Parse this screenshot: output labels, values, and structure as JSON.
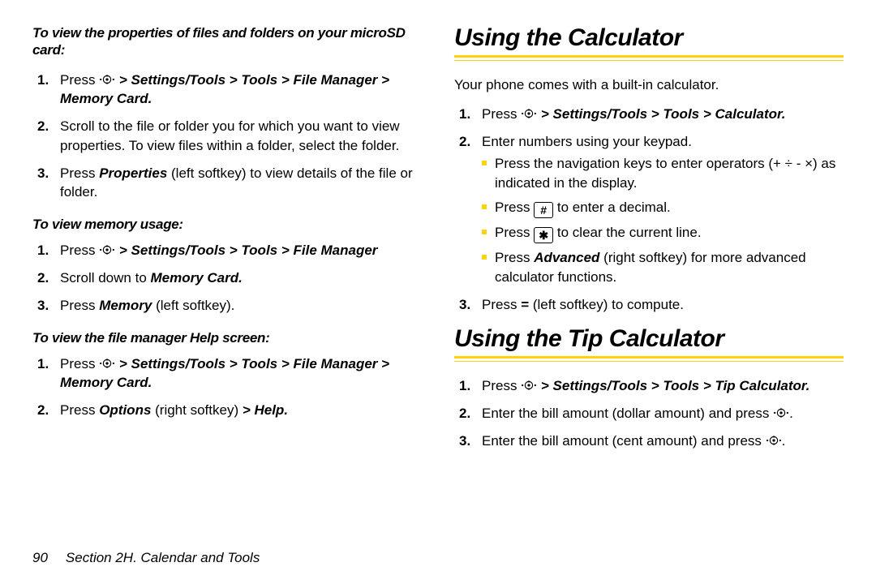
{
  "left": {
    "intro1": "To view the properties of files and folders on your microSD card:",
    "steps1": {
      "s1a": "Press ",
      "s1b": " > Settings/Tools > Tools > File Manager > Memory Card.",
      "s2": "Scroll to the file or folder you for which you want to view properties. To view files within a folder, select the folder.",
      "s3a": "Press ",
      "s3b": "Properties",
      "s3c": " (left softkey) to view details of the file or folder."
    },
    "sub2": "To view memory usage:",
    "steps2": {
      "s1a": "Press ",
      "s1b": " > Settings/Tools > Tools > File Manager",
      "s2a": "Scroll down to ",
      "s2b": "Memory Card.",
      "s3a": "Press ",
      "s3b": "Memory",
      "s3c": " (left softkey)."
    },
    "sub3": "To view the file manager Help screen:",
    "steps3": {
      "s1a": "Press ",
      "s1b": " > Settings/Tools > Tools > File Manager > Memory Card.",
      "s2a": "Press ",
      "s2b": "Options",
      "s2c": " (right softkey) ",
      "s2d": "> Help."
    }
  },
  "right": {
    "h1": "Using the Calculator",
    "intro1": "Your phone comes with a built-in calculator.",
    "steps1": {
      "s1a": "Press ",
      "s1b": " > Settings/Tools > Tools > Calculator.",
      "s2": "Enter numbers using your keypad.",
      "sub1a": "Press the navigation keys to enter operators (+ ",
      "sub1b": "÷",
      "sub1c": " - ×) as indicated in the display.",
      "sub2a": "Press ",
      "sub2b": " to enter a decimal.",
      "sub3a": "Press ",
      "sub3b": " to clear the current line.",
      "sub4a": "Press ",
      "sub4b": "Advanced",
      "sub4c": " (right softkey) for more advanced calculator functions.",
      "s3a": "Press ",
      "s3b": "=",
      "s3c": " (left softkey) to compute."
    },
    "h2": "Using the Tip Calculator",
    "steps2": {
      "s1a": "Press ",
      "s1b": " > Settings/Tools > Tools > Tip Calculator.",
      "s2a": "Enter the bill amount (dollar amount) and press ",
      "s2b": ".",
      "s3a": "Enter the bill amount (cent amount) and press ",
      "s3b": "."
    }
  },
  "keys": {
    "hash": "#",
    "star": "✱"
  },
  "footer": {
    "page": "90",
    "section": "Section 2H. Calendar and Tools"
  }
}
